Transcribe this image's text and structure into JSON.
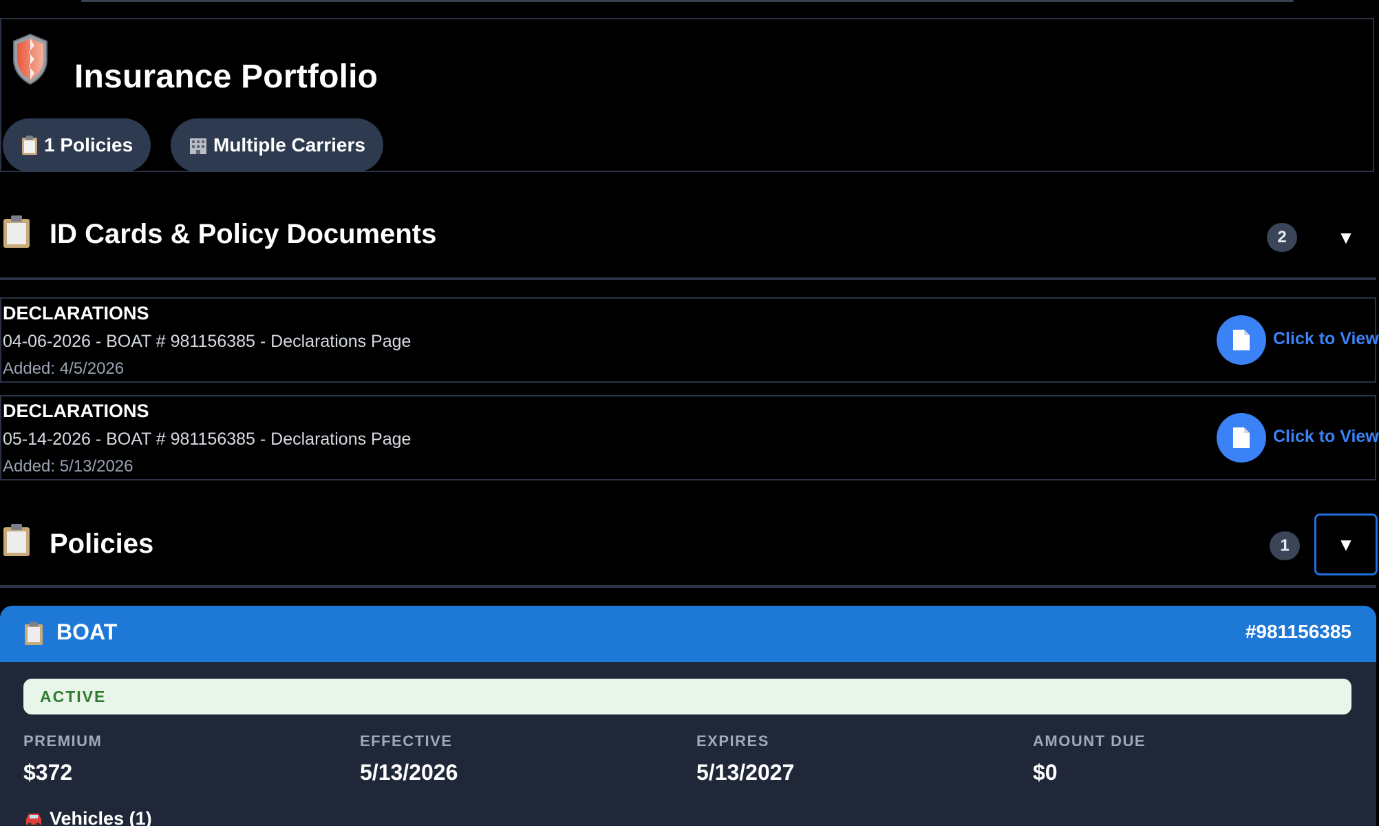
{
  "header": {
    "title": "Insurance Portfolio",
    "pills": [
      {
        "label": "1 Policies",
        "icon": "clipboard-icon"
      },
      {
        "label": "Multiple Carriers",
        "icon": "building-icon"
      }
    ]
  },
  "documents_section": {
    "title": "ID Cards & Policy Documents",
    "count": "2",
    "toggle": "▼",
    "items": [
      {
        "type": "DECLARATIONS",
        "description": "04-06-2026 - BOAT # 981156385 - Declarations Page",
        "added": "Added: 4/5/2026",
        "view_label": "Click to View"
      },
      {
        "type": "DECLARATIONS",
        "description": "05-14-2026 - BOAT # 981156385 - Declarations Page",
        "added": "Added: 5/13/2026",
        "view_label": "Click to View"
      }
    ]
  },
  "policies_section": {
    "title": "Policies",
    "count": "1",
    "toggle": "▼",
    "policy": {
      "type": "BOAT",
      "number": "#981156385",
      "status": "ACTIVE",
      "stats": [
        {
          "label": "PREMIUM",
          "value": "$372"
        },
        {
          "label": "EFFECTIVE",
          "value": "5/13/2026"
        },
        {
          "label": "EXPIRES",
          "value": "5/13/2027"
        },
        {
          "label": "AMOUNT DUE",
          "value": "$0"
        }
      ],
      "vehicles_label": "Vehicles (1)"
    }
  },
  "colors": {
    "accent_blue": "#1e78d6",
    "link_blue": "#3b82f6",
    "status_green": "#2e7d32",
    "status_bg": "#e8f5e8",
    "card_bg": "#1f2738"
  }
}
